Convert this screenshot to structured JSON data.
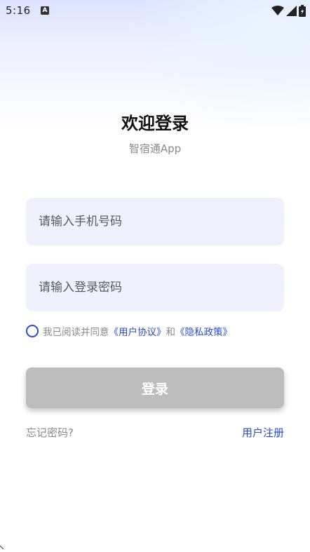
{
  "status_bar": {
    "time": "5:16",
    "app_icon_letter": "A",
    "icons": [
      "wifi-icon",
      "signal-icon",
      "battery-icon"
    ]
  },
  "header": {
    "title": "欢迎登录",
    "subtitle": "智宿通App"
  },
  "form": {
    "phone_placeholder": "请输入手机号码",
    "password_placeholder": "请输入登录密码",
    "agreement": {
      "prefix": "我已阅读并同意",
      "user_agreement": "《用户协议》",
      "conjunction": "和",
      "privacy_policy": "《隐私政策》"
    },
    "login_label": "登录"
  },
  "footer": {
    "forgot_password": "忘记密码?",
    "register": "用户注册"
  },
  "colors": {
    "accent": "#2a4bd0",
    "input_bg": "#eff1fe",
    "button_disabled": "#bdbdbd",
    "muted_text": "#8a8a8a"
  }
}
